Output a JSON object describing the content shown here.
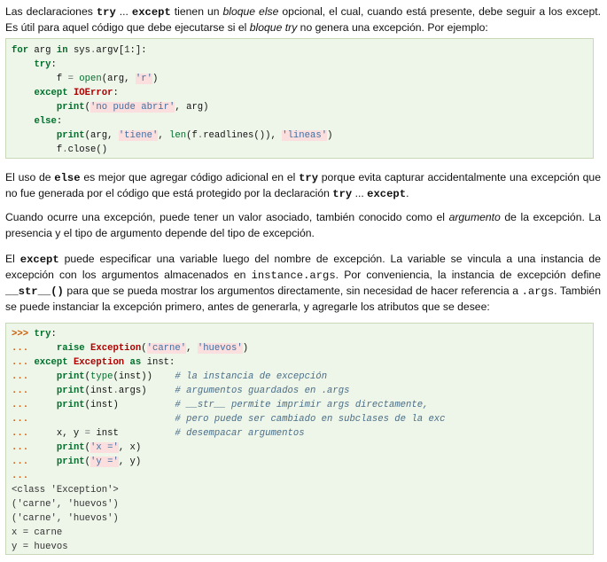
{
  "p1": {
    "l1_a": "Las declaraciones ",
    "l1_kw1": "try",
    "l1_b": " ... ",
    "l1_kw2": "except",
    "l1_c": " tienen un ",
    "l1_em": "bloque else",
    "l1_d": " opcional, el cual, cuando está presente, debe seguir a los except.",
    "l2_a": "Es útil para aquel código que debe ejecutarse si el ",
    "l2_em": "bloque try",
    "l2_b": " no genera una excepción. Por ejemplo:"
  },
  "code1": [
    "for arg in sys.argv[1:]:",
    "    try:",
    "        f = open(arg, 'r')",
    "    except IOError:",
    "        print('no pude abrir', arg)",
    "    else:",
    "        print(arg, 'tiene', len(f.readlines()), 'lineas')",
    "        f.close()"
  ],
  "p2": {
    "l1_a": "El uso de ",
    "l1_kw": "else",
    "l1_b": " es mejor que agregar código adicional en el ",
    "l1_kw2": "try",
    "l1_c": " porque evita capturar accidentalmente una excepción que",
    "l2_a": "no fue generada por el código que está protegido por la declaración ",
    "l2_kw1": "try",
    "l2_b": " ... ",
    "l2_kw2": "except",
    "l2_c": "."
  },
  "p3": {
    "l1_a": "Cuando ocurre una excepción, puede tener un valor asociado, también conocido como el ",
    "l1_em": "argumento",
    "l1_b": " de la excepción. La",
    "l2": "presencia y el tipo de argumento depende del tipo de excepción."
  },
  "p4": {
    "l1_a": "El ",
    "l1_kw": "except",
    "l1_b": " puede especificar una variable luego del nombre de excepción. La variable se vincula a una instancia de",
    "l2_a": "excepción con los argumentos almacenados en ",
    "l2_mono": "instance.args",
    "l2_b": ". Por conveniencia, la instancia de excepción define",
    "l3_kw": "__str__()",
    "l3_a": " para que se pueda mostrar los argumentos directamente, sin necesidad de hacer referencia a ",
    "l3_mono": ".args",
    "l3_b": ". También",
    "l4": "se puede instanciar la excepción primero, antes de generarla, y agregarle los atributos que se desee:"
  },
  "code2": {
    "prompt1": ">>>",
    "prompt2": "...",
    "lines": [
      ">>> try:",
      "...     raise Exception('carne', 'huevos')",
      "... except Exception as inst:",
      "...     print(type(inst))    # la instancia de excepción",
      "...     print(inst.args)     # argumentos guardados en .args",
      "...     print(inst)          # __str__ permite imprimir args directamente,",
      "...                          # pero puede ser cambiado en subclases de la exc",
      "...     x, y = inst          # desempacar argumentos",
      "...     print('x =', x)",
      "...     print('y =', y)",
      "...",
      "<class 'Exception'>",
      "('carne', 'huevos')",
      "('carne', 'huevos')",
      "x = carne",
      "y = huevos"
    ]
  }
}
